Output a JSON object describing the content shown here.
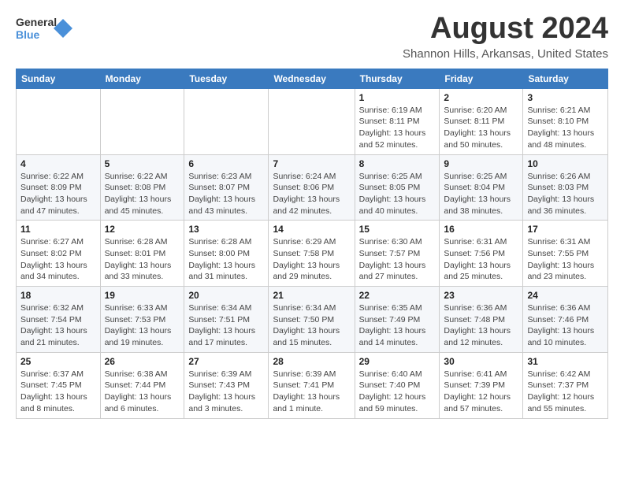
{
  "logo": {
    "line1": "General",
    "line2": "Blue"
  },
  "header": {
    "month_year": "August 2024",
    "location": "Shannon Hills, Arkansas, United States"
  },
  "weekdays": [
    "Sunday",
    "Monday",
    "Tuesday",
    "Wednesday",
    "Thursday",
    "Friday",
    "Saturday"
  ],
  "weeks": [
    [
      {
        "day": "",
        "info": ""
      },
      {
        "day": "",
        "info": ""
      },
      {
        "day": "",
        "info": ""
      },
      {
        "day": "",
        "info": ""
      },
      {
        "day": "1",
        "info": "Sunrise: 6:19 AM\nSunset: 8:11 PM\nDaylight: 13 hours\nand 52 minutes."
      },
      {
        "day": "2",
        "info": "Sunrise: 6:20 AM\nSunset: 8:11 PM\nDaylight: 13 hours\nand 50 minutes."
      },
      {
        "day": "3",
        "info": "Sunrise: 6:21 AM\nSunset: 8:10 PM\nDaylight: 13 hours\nand 48 minutes."
      }
    ],
    [
      {
        "day": "4",
        "info": "Sunrise: 6:22 AM\nSunset: 8:09 PM\nDaylight: 13 hours\nand 47 minutes."
      },
      {
        "day": "5",
        "info": "Sunrise: 6:22 AM\nSunset: 8:08 PM\nDaylight: 13 hours\nand 45 minutes."
      },
      {
        "day": "6",
        "info": "Sunrise: 6:23 AM\nSunset: 8:07 PM\nDaylight: 13 hours\nand 43 minutes."
      },
      {
        "day": "7",
        "info": "Sunrise: 6:24 AM\nSunset: 8:06 PM\nDaylight: 13 hours\nand 42 minutes."
      },
      {
        "day": "8",
        "info": "Sunrise: 6:25 AM\nSunset: 8:05 PM\nDaylight: 13 hours\nand 40 minutes."
      },
      {
        "day": "9",
        "info": "Sunrise: 6:25 AM\nSunset: 8:04 PM\nDaylight: 13 hours\nand 38 minutes."
      },
      {
        "day": "10",
        "info": "Sunrise: 6:26 AM\nSunset: 8:03 PM\nDaylight: 13 hours\nand 36 minutes."
      }
    ],
    [
      {
        "day": "11",
        "info": "Sunrise: 6:27 AM\nSunset: 8:02 PM\nDaylight: 13 hours\nand 34 minutes."
      },
      {
        "day": "12",
        "info": "Sunrise: 6:28 AM\nSunset: 8:01 PM\nDaylight: 13 hours\nand 33 minutes."
      },
      {
        "day": "13",
        "info": "Sunrise: 6:28 AM\nSunset: 8:00 PM\nDaylight: 13 hours\nand 31 minutes."
      },
      {
        "day": "14",
        "info": "Sunrise: 6:29 AM\nSunset: 7:58 PM\nDaylight: 13 hours\nand 29 minutes."
      },
      {
        "day": "15",
        "info": "Sunrise: 6:30 AM\nSunset: 7:57 PM\nDaylight: 13 hours\nand 27 minutes."
      },
      {
        "day": "16",
        "info": "Sunrise: 6:31 AM\nSunset: 7:56 PM\nDaylight: 13 hours\nand 25 minutes."
      },
      {
        "day": "17",
        "info": "Sunrise: 6:31 AM\nSunset: 7:55 PM\nDaylight: 13 hours\nand 23 minutes."
      }
    ],
    [
      {
        "day": "18",
        "info": "Sunrise: 6:32 AM\nSunset: 7:54 PM\nDaylight: 13 hours\nand 21 minutes."
      },
      {
        "day": "19",
        "info": "Sunrise: 6:33 AM\nSunset: 7:53 PM\nDaylight: 13 hours\nand 19 minutes."
      },
      {
        "day": "20",
        "info": "Sunrise: 6:34 AM\nSunset: 7:51 PM\nDaylight: 13 hours\nand 17 minutes."
      },
      {
        "day": "21",
        "info": "Sunrise: 6:34 AM\nSunset: 7:50 PM\nDaylight: 13 hours\nand 15 minutes."
      },
      {
        "day": "22",
        "info": "Sunrise: 6:35 AM\nSunset: 7:49 PM\nDaylight: 13 hours\nand 14 minutes."
      },
      {
        "day": "23",
        "info": "Sunrise: 6:36 AM\nSunset: 7:48 PM\nDaylight: 13 hours\nand 12 minutes."
      },
      {
        "day": "24",
        "info": "Sunrise: 6:36 AM\nSunset: 7:46 PM\nDaylight: 13 hours\nand 10 minutes."
      }
    ],
    [
      {
        "day": "25",
        "info": "Sunrise: 6:37 AM\nSunset: 7:45 PM\nDaylight: 13 hours\nand 8 minutes."
      },
      {
        "day": "26",
        "info": "Sunrise: 6:38 AM\nSunset: 7:44 PM\nDaylight: 13 hours\nand 6 minutes."
      },
      {
        "day": "27",
        "info": "Sunrise: 6:39 AM\nSunset: 7:43 PM\nDaylight: 13 hours\nand 3 minutes."
      },
      {
        "day": "28",
        "info": "Sunrise: 6:39 AM\nSunset: 7:41 PM\nDaylight: 13 hours\nand 1 minute."
      },
      {
        "day": "29",
        "info": "Sunrise: 6:40 AM\nSunset: 7:40 PM\nDaylight: 12 hours\nand 59 minutes."
      },
      {
        "day": "30",
        "info": "Sunrise: 6:41 AM\nSunset: 7:39 PM\nDaylight: 12 hours\nand 57 minutes."
      },
      {
        "day": "31",
        "info": "Sunrise: 6:42 AM\nSunset: 7:37 PM\nDaylight: 12 hours\nand 55 minutes."
      }
    ]
  ]
}
